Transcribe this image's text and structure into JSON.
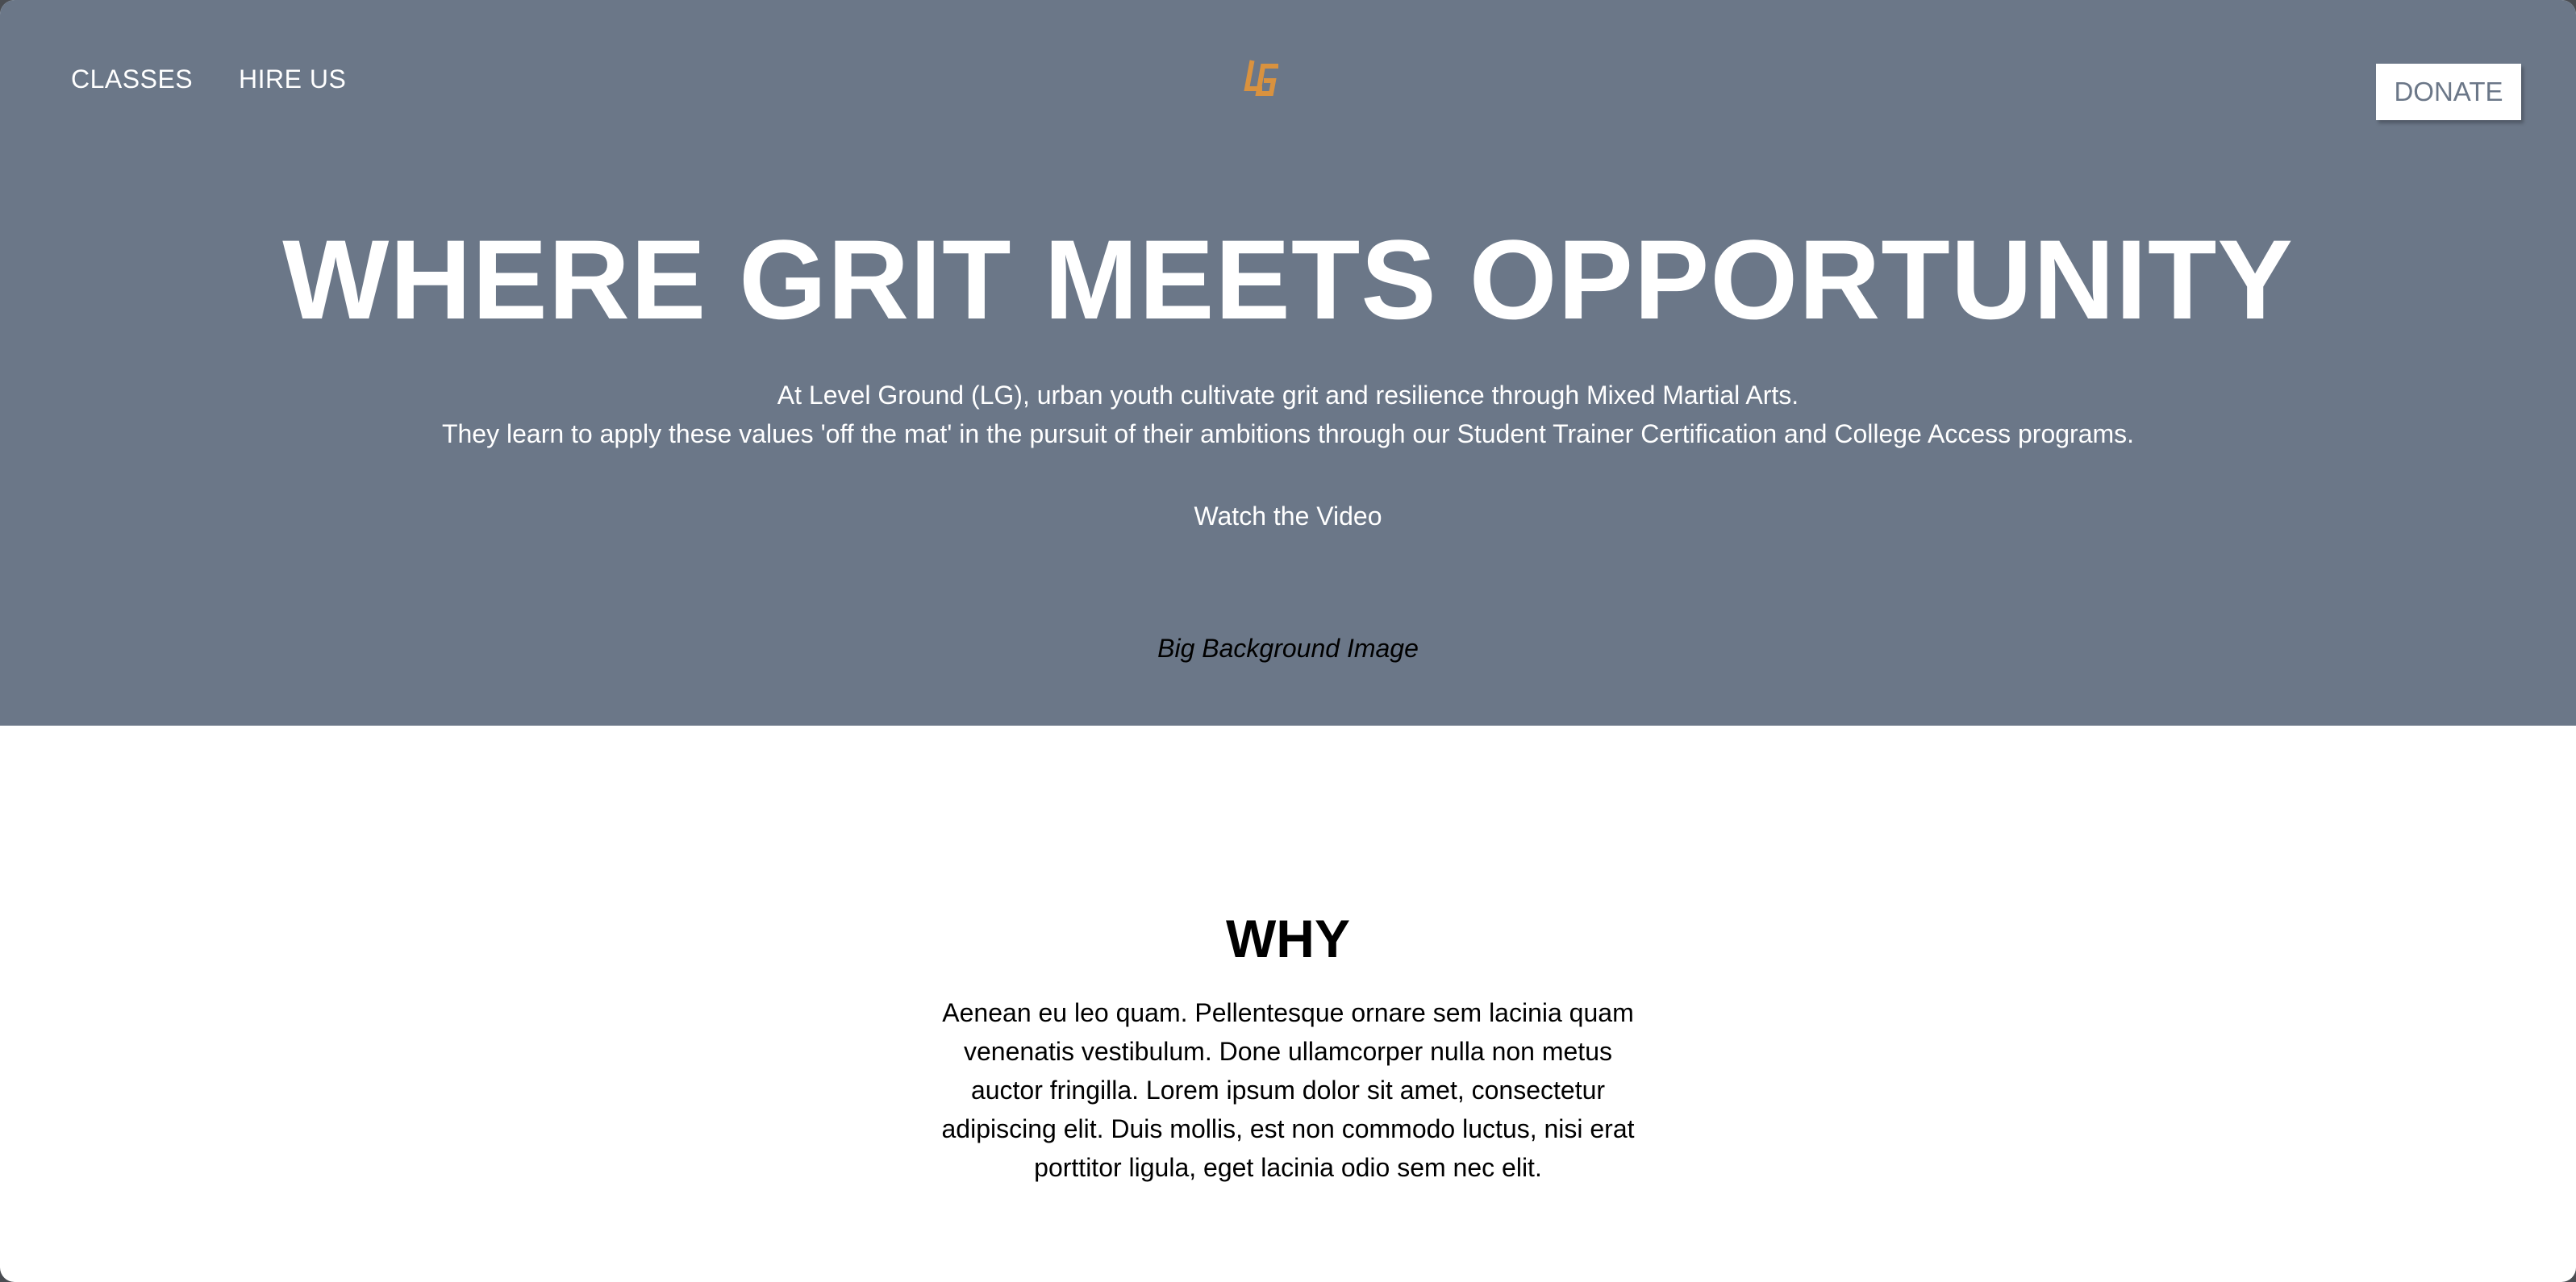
{
  "nav": {
    "classes": "CLASSES",
    "hire_us": "HIRE US",
    "donate": "DONATE"
  },
  "logo": {
    "icon": "lg-logo-icon",
    "text": "LG",
    "color": "#d9923f"
  },
  "hero": {
    "title": "WHERE GRIT MEETS OPPORTUNITY",
    "subtitle_line1": "At Level Ground (LG), urban youth cultivate grit and resilience through Mixed Martial Arts.",
    "subtitle_line2": "They learn to apply these values 'off the mat' in the pursuit of their ambitions through our Student Trainer Certification and College Access programs.",
    "video_link": "Watch the Video",
    "background_caption": "Big Background Image",
    "background_color": "#6b7788"
  },
  "why": {
    "title": "WHY",
    "body": "Aenean eu leo quam. Pellentesque ornare sem lacinia quam venenatis vestibulum. Done ullamcorper nulla non metus auctor fringilla. Lorem ipsum dolor sit amet, consectetur adipiscing elit. Duis mollis, est non commodo luctus, nisi erat porttitor ligula, eget lacinia odio sem nec elit."
  }
}
